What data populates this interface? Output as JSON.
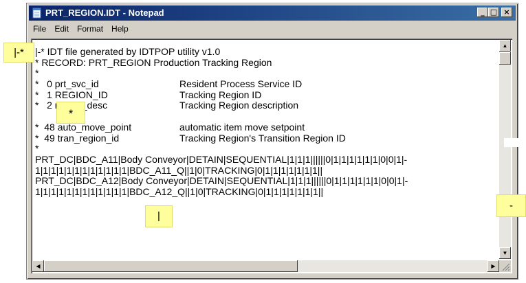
{
  "window": {
    "title": "PRT_REGION.IDT - Notepad",
    "controls": {
      "minimize": "_",
      "maximize": "□",
      "close": "×"
    }
  },
  "menu": [
    "File",
    "Edit",
    "Format",
    "Help"
  ],
  "editor": {
    "lines": [
      "|-* IDT file generated by IDTPOP utility v1.0",
      "* RECORD: PRT_REGION Production Tracking Region",
      "*",
      {
        "a": "*   0 prt_svc_id",
        "b": "Resident Process Service ID"
      },
      {
        "a": "*   1 REGION_ID",
        "b": "Tracking Region ID"
      },
      {
        "a": "*   2 region_desc",
        "b": "Tracking Region description"
      },
      "",
      {
        "a": "*  48 auto_move_point",
        "b": "automatic item move setpoint"
      },
      {
        "a": "*  49 tran_region_id",
        "b": "Tracking Region's Transition Region ID"
      },
      "*",
      "PRT_DC|BDC_A11|Body Conveyor|DETAIN|SEQUENTIAL|1|1|1||||||0|1|1|1|1|1|1|0|0|1|-",
      "1|1|1|1|1|1|1|1|1|1|1|1|BDC_A11_Q||1|0|TRACKING|0|1|1|1|1|1|1|1||",
      "PRT_DC|BDC_A12|Body Conveyor|DETAIN|SEQUENTIAL|1|1|1||||||0|1|1|1|1|1|1|0|0|1|-",
      "1|1|1|1|1|1|1|1|1|1|1|1|BDC_A12_Q||1|0|TRACKING|0|1|1|1|1|1|1|1||"
    ]
  },
  "callouts": {
    "comment_marker": "|-*",
    "asterisk": "*",
    "pipe": "|",
    "dash": "-"
  },
  "colors": {
    "title_bar_start": "#0a246a",
    "title_bar_end": "#3a6ea5",
    "callout_fill": "#fefe9c",
    "chrome": "#d4d0c8"
  },
  "icons": {
    "app": "notepad-icon",
    "scroll_up": "arrow-up-icon",
    "scroll_down": "arrow-down-icon",
    "scroll_left": "arrow-left-icon",
    "scroll_right": "arrow-right-icon",
    "resize": "size-grip-icon"
  }
}
